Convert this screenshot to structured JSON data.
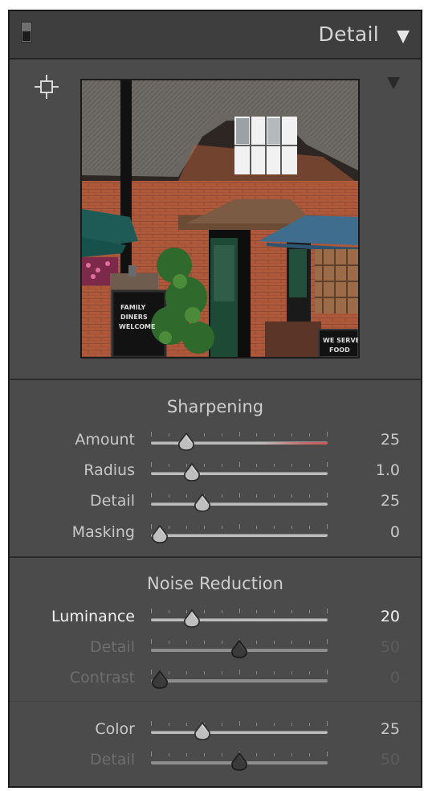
{
  "header": {
    "title": "Detail",
    "toggle_icon": "panel-switch-icon",
    "collapse_icon": "triangle-down-icon"
  },
  "preview": {
    "target_icon": "target-crosshair-icon",
    "menu_icon": "triangle-down-icon",
    "chalkboard_left": [
      "FAMILY",
      "DINERS",
      "WELCOME"
    ],
    "chalkboard_right": [
      "WE SERVE",
      "FOOD"
    ]
  },
  "sharpening": {
    "title": "Sharpening",
    "sliders": [
      {
        "label": "Amount",
        "value": "25",
        "pos": 0.2,
        "state": "normal"
      },
      {
        "label": "Radius",
        "value": "1.0",
        "pos": 0.23,
        "state": "normal"
      },
      {
        "label": "Detail",
        "value": "25",
        "pos": 0.29,
        "state": "normal"
      },
      {
        "label": "Masking",
        "value": "0",
        "pos": 0.05,
        "state": "normal"
      }
    ]
  },
  "noise_reduction": {
    "title": "Noise Reduction",
    "luminance_sliders": [
      {
        "label": "Luminance",
        "value": "20",
        "pos": 0.23,
        "state": "active"
      },
      {
        "label": "Detail",
        "value": "50",
        "pos": 0.5,
        "state": "disabled"
      },
      {
        "label": "Contrast",
        "value": "0",
        "pos": 0.05,
        "state": "disabled"
      }
    ],
    "color_sliders": [
      {
        "label": "Color",
        "value": "25",
        "pos": 0.29,
        "state": "normal"
      },
      {
        "label": "Detail",
        "value": "50",
        "pos": 0.5,
        "state": "disabled"
      }
    ]
  },
  "colors": {
    "panel_bg": "#4b4b4b",
    "header_bg": "#3e3e3e",
    "text": "#c8c8c8",
    "text_dim": "#6e6e6e",
    "amount_track_accent": "#c85a5a"
  }
}
